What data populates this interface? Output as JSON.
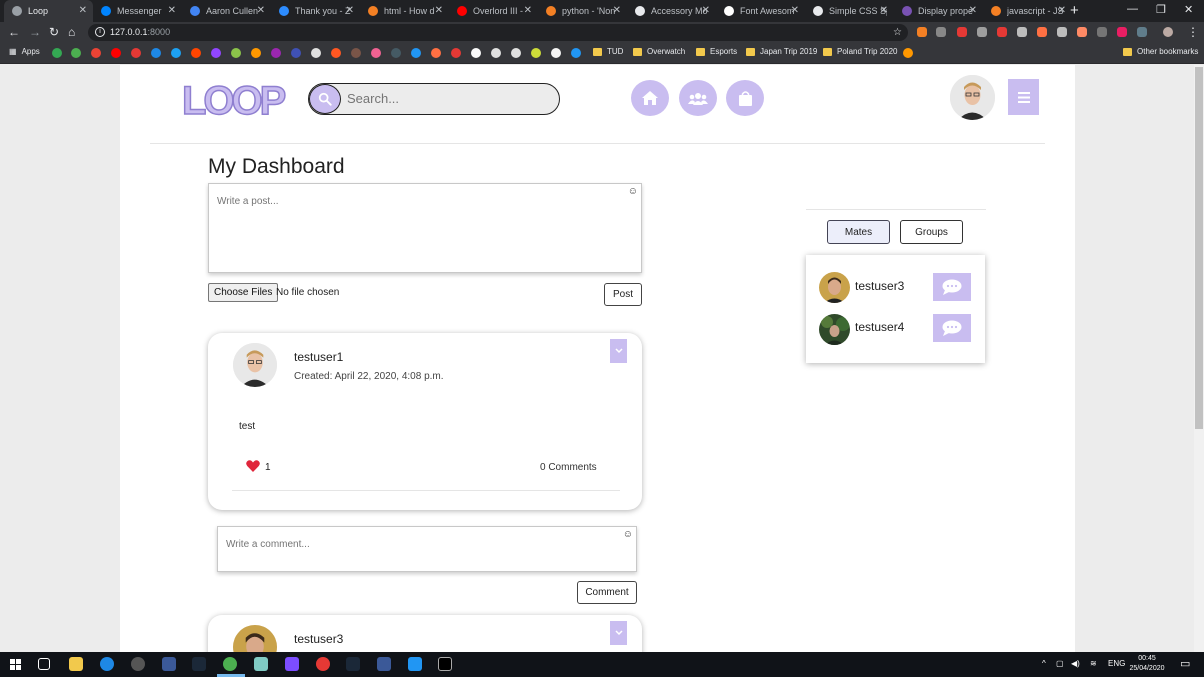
{
  "browser": {
    "tabs": [
      {
        "label": "Loop",
        "color": "#9aa0a6",
        "active": true
      },
      {
        "label": "Messenger",
        "color": "#0084ff"
      },
      {
        "label": "Aaron Cullen",
        "color": "#4285f4"
      },
      {
        "label": "Thank you - Z",
        "color": "#2d8cff"
      },
      {
        "label": "html - How d",
        "color": "#f48024"
      },
      {
        "label": "Overlord III -",
        "color": "#ff0000"
      },
      {
        "label": "python - 'Non",
        "color": "#f48024"
      },
      {
        "label": "Accessory Mo",
        "color": "#e8eaed"
      },
      {
        "label": "Font Awesom",
        "color": "#ffffff"
      },
      {
        "label": "Simple CSS Sp",
        "color": "#e8eaed"
      },
      {
        "label": "Display prope",
        "color": "#7952b3"
      },
      {
        "label": "javascript - JS",
        "color": "#f48024"
      }
    ],
    "url_host": "127.0.0.1",
    "url_port": ":8000",
    "bookmarks": {
      "apps_label": "Apps",
      "folders": [
        "TUD",
        "Overwatch",
        "Esports",
        "Japan Trip 2019",
        "Poland Trip 2020"
      ],
      "other_label": "Other bookmarks"
    }
  },
  "header": {
    "logo_text": "LOOP",
    "search_placeholder": "Search...",
    "nav_icons": [
      "home-icon",
      "users-icon",
      "shopping-bag-icon"
    ],
    "menu_icon": "bars-icon"
  },
  "dashboard": {
    "title": "My Dashboard",
    "post_placeholder": "Write a post...",
    "choose_files_label": "Choose Files",
    "no_file_label": "No file chosen",
    "post_button": "Post"
  },
  "posts": [
    {
      "username": "testuser1",
      "created": "Created: April 22, 2020, 4:08 p.m.",
      "body": "test",
      "likes": "1",
      "comments_label": "0 Comments"
    },
    {
      "username": "testuser3"
    }
  ],
  "comment": {
    "placeholder": "Write a comment...",
    "button": "Comment"
  },
  "sidebar": {
    "tabs": [
      "Mates",
      "Groups"
    ],
    "selected_tab": "Mates",
    "mates": [
      {
        "name": "testuser3"
      },
      {
        "name": "testuser4"
      }
    ]
  },
  "taskbar": {
    "language": "ENG",
    "time": "00:45",
    "date": "25/04/2020"
  },
  "colors": {
    "accent": "#c9bdf0",
    "heart": "#e0263b"
  }
}
